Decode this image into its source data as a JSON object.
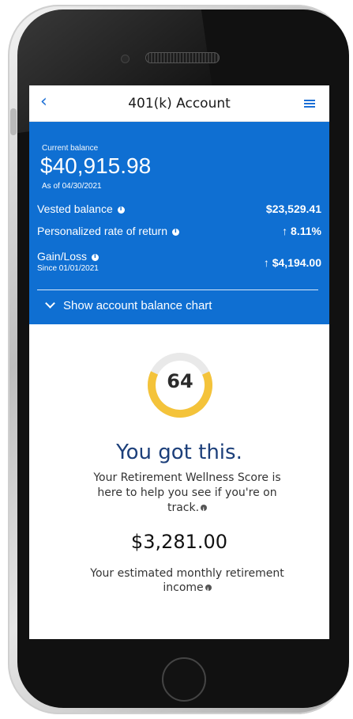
{
  "nav": {
    "back_icon": "chevron-left-icon",
    "title": "401(k) Account",
    "menu_icon": "hamburger-menu-icon"
  },
  "balance": {
    "current_label": "Current balance",
    "current_value": "$40,915.98",
    "as_of": "As of 04/30/2021",
    "vested_label": "Vested balance",
    "vested_value": "$23,529.41",
    "rate_label": "Personalized rate of return",
    "rate_value": "↑ 8.11%",
    "gain_label": "Gain/Loss",
    "gain_since": "Since 01/01/2021",
    "gain_value": "↑ $4,194.00",
    "chart_toggle": "Show account balance chart"
  },
  "wellness": {
    "score": "64",
    "score_fraction": 0.64,
    "headline": "You got this.",
    "description": "Your Retirement Wellness Score is here to help you see if you're on track.",
    "monthly_income": "$3,281.00",
    "monthly_income_label": "Your estimated monthly retirement income"
  },
  "colors": {
    "brand_blue": "#0f6fd2",
    "accent_blue": "#1b6fd6",
    "gauge_yellow": "#f4c33a",
    "gauge_track": "#e9e9e9",
    "headline_navy": "#1c3f7a"
  }
}
